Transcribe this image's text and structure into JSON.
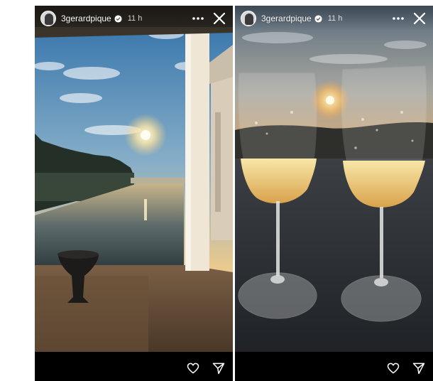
{
  "stories": [
    {
      "username": "3gerardpique",
      "time": "11 h",
      "icons": {
        "avatar": "profile-avatar",
        "verified": "verified-badge-icon",
        "more": "more-icon",
        "close": "close-icon",
        "like": "heart-icon",
        "share": "send-icon"
      }
    },
    {
      "username": "3gerardpique",
      "time": "11 h",
      "icons": {
        "avatar": "profile-avatar",
        "verified": "verified-badge-icon",
        "more": "more-icon",
        "close": "close-icon",
        "like": "heart-icon",
        "share": "send-icon"
      }
    }
  ],
  "colors": {
    "background": "#ffffff",
    "story_bar": "#000000",
    "text": "#ffffff"
  }
}
